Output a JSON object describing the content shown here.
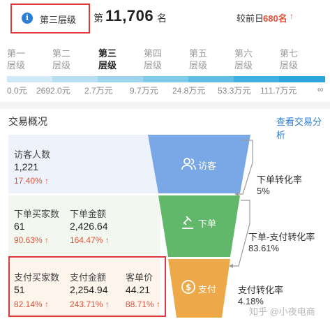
{
  "header": {
    "tier_label": "第三层级",
    "rank_prefix": "第",
    "rank_number": "11,706",
    "rank_suffix": "名",
    "prev_day_label": "较前日",
    "prev_day_value": "680名",
    "prev_day_arrow": "↑"
  },
  "tiers": [
    {
      "line1": "第一",
      "line2": "层级",
      "active": false
    },
    {
      "line1": "第二",
      "line2": "层级",
      "active": false
    },
    {
      "line1": "第三",
      "line2": "层级",
      "active": true
    },
    {
      "line1": "第四",
      "line2": "层级",
      "active": false
    },
    {
      "line1": "第五",
      "line2": "层级",
      "active": false
    },
    {
      "line1": "第六",
      "line2": "层级",
      "active": false
    },
    {
      "line1": "第七",
      "line2": "层级",
      "active": false
    }
  ],
  "scale": {
    "labels": [
      "0.0元",
      "2692.0元",
      "2.7万元",
      "9.7万元",
      "24.8万元",
      "53.3万元",
      "111.7万元",
      "∞"
    ],
    "colors": [
      "#cfe9f7",
      "#b6dff3",
      "#9dd5ef",
      "#7fcaeb",
      "#5fbde6",
      "#3fb0e1",
      "#2aa6dd"
    ]
  },
  "overview": {
    "title": "交易概况",
    "link": "查看交易分析"
  },
  "visitors": {
    "label": "访客人数",
    "value": "1,221",
    "pct": "17.40%",
    "arrow": "↑"
  },
  "order": {
    "buyers_label": "下单买家数",
    "buyers_value": "61",
    "buyers_pct": "90.63%",
    "amount_label": "下单金额",
    "amount_value": "2,426.64",
    "amount_pct": "164.47%",
    "arrow": "↑"
  },
  "payment": {
    "buyers_label": "支付买家数",
    "buyers_value": "51",
    "buyers_pct": "82.14%",
    "amount_label": "支付金额",
    "amount_value": "2,254.94",
    "amount_pct": "243.71%",
    "avg_label": "客单价",
    "avg_value": "44.21",
    "avg_pct": "88.71%",
    "arrow": "↑"
  },
  "funnel": {
    "visit_label": "访客",
    "order_label": "下单",
    "pay_label": "支付",
    "visit_color": "#7aa8e6",
    "order_color": "#62b86a",
    "pay_color": "#eda84a"
  },
  "rates": {
    "order_label": "下单转化率",
    "order_value": "5%",
    "order_pay_label": "下单-支付转化率",
    "order_pay_value": "83.61%",
    "pay_label": "支付转化率",
    "pay_value": "4.18%"
  },
  "watermark": "知乎 @小夜电商"
}
